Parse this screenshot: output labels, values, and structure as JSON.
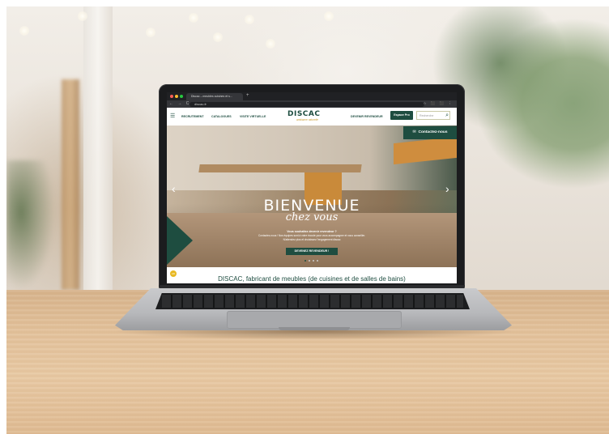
{
  "browser": {
    "tab_title": "Discac – meubles cuisines et s...",
    "tab_plus": "+",
    "url": "discac.fr",
    "nav_icons": "← → C",
    "ext_icons": "☆ ⬛ ⬛ ⋮"
  },
  "header": {
    "nav": [
      "RECRUTEMENT",
      "CATALOGUES",
      "VISITE VIRTUELLE"
    ],
    "logo": "DISCAC",
    "logo_tagline": "ambiance naturelle",
    "devenir": "DEVENIR REVENDEUR",
    "espace_pro": "Espace Pro",
    "search_placeholder": "Recherche"
  },
  "hero": {
    "contact": "Contactez-nous",
    "title": "BIENVENUE",
    "subtitle": "chez vous",
    "text1": "Vous souhaitez devenir revendeur ?",
    "text2a": "Contactez-nous ! Nos équipes sont à votre écoute pour vous accompagner et vous conseiller.",
    "text2b": "N'attendez plus et choisissez l'engagement discac",
    "button": "DEVENEZ REVENDEUR !",
    "prev": "‹",
    "next": "›"
  },
  "section": {
    "title": "DISCAC, fabricant de meubles (de cuisines et de salles de bains)",
    "badge": "AD"
  },
  "colors": {
    "brand_green": "#1e4d40",
    "brand_gold": "#c89a2d"
  }
}
